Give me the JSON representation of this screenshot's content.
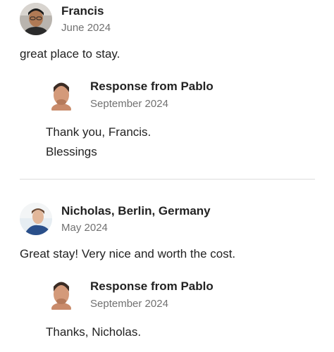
{
  "reviews": [
    {
      "reviewer_name": "Francis",
      "date": "June 2024",
      "text": "great place to stay.",
      "response": {
        "title": "Response from Pablo",
        "date": "September 2024",
        "lines": [
          "Thank you, Francis.",
          "Blessings"
        ]
      }
    },
    {
      "reviewer_name": "Nicholas, Berlin, Germany",
      "date": "May 2024",
      "text": "Great stay! Very nice and worth the cost.",
      "response": {
        "title": "Response from Pablo",
        "date": "September 2024",
        "lines": [
          "Thanks, Nicholas."
        ]
      }
    }
  ],
  "colors": {
    "primary_text": "#222222",
    "secondary_text": "#717171",
    "divider": "#dddddd"
  },
  "icons": {
    "reviewer_avatar": "person-photo-avatar",
    "host_avatar": "host-photo-avatar"
  }
}
